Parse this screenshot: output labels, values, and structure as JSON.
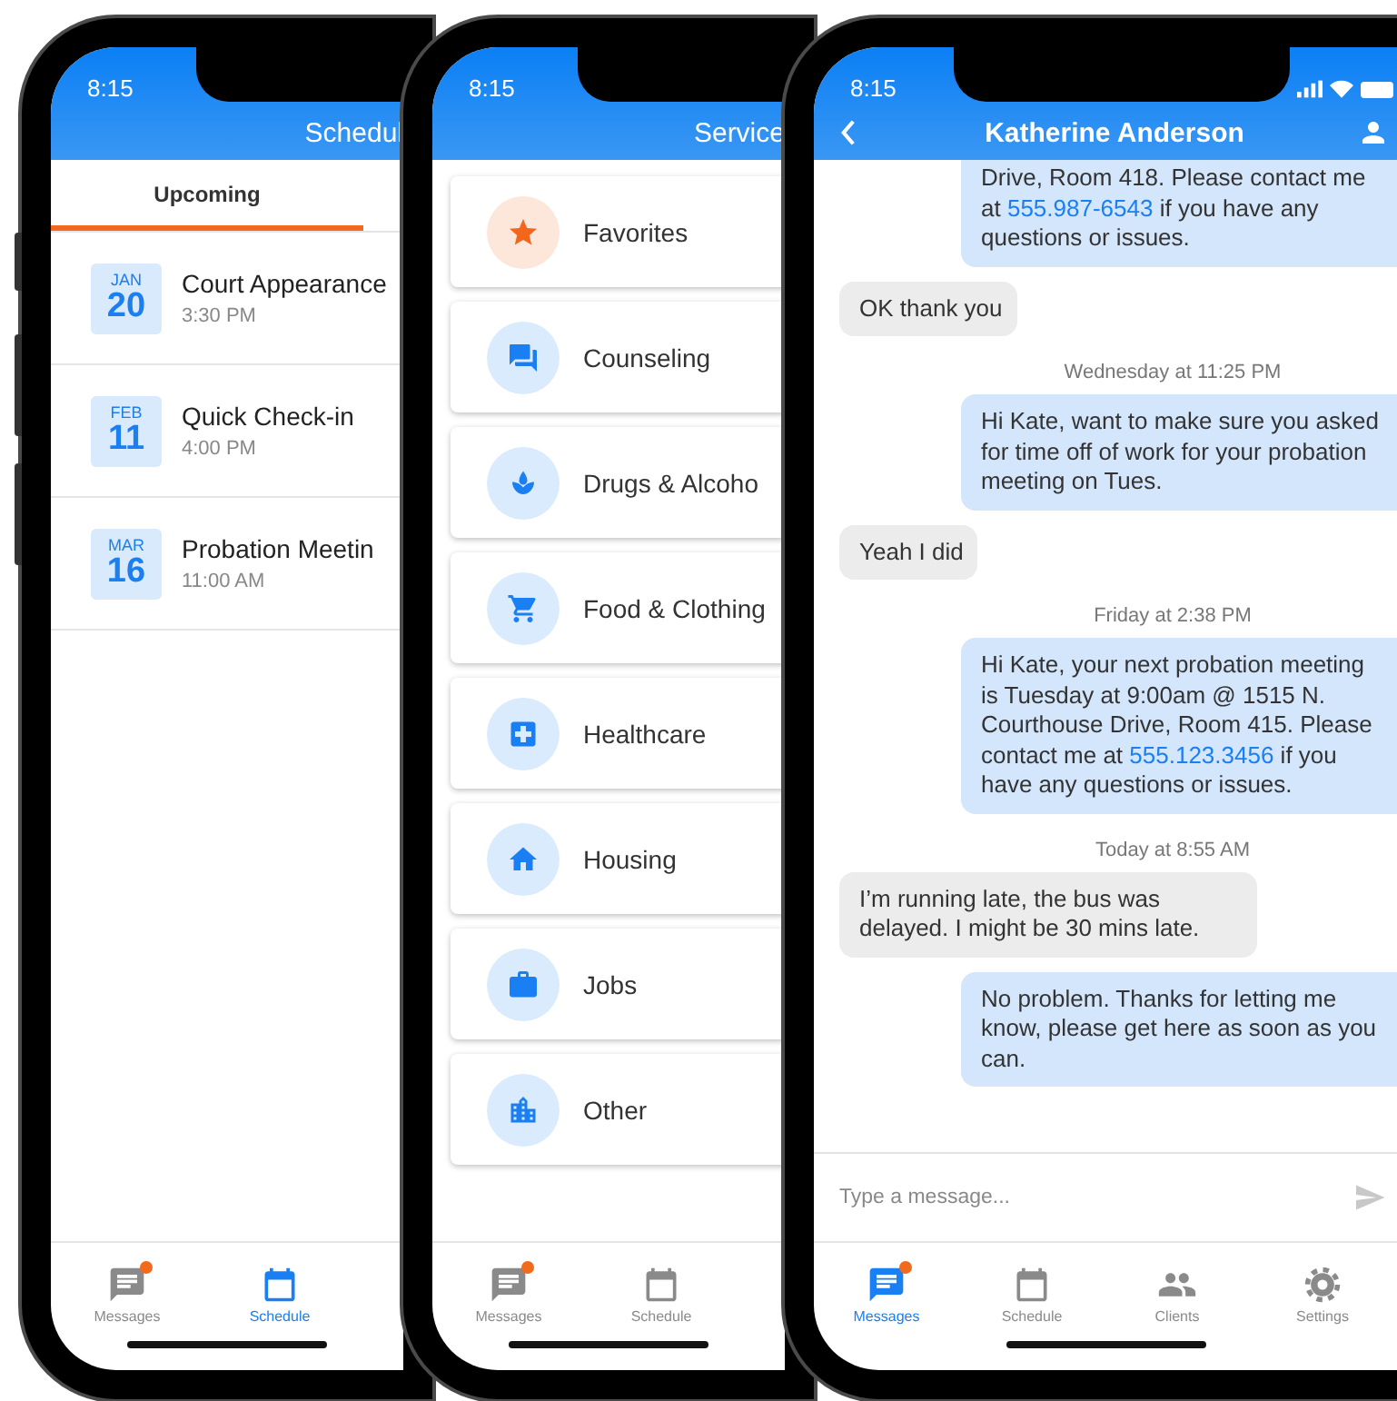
{
  "phones": [
    {
      "kind": "schedule",
      "status_time": "8:15",
      "header": {
        "title": "Schedul"
      },
      "tabs": [
        {
          "label": "Upcoming",
          "selected": true
        }
      ],
      "events": [
        {
          "month": "JAN",
          "day": "20",
          "title": "Court Appearance",
          "time": "3:30 PM"
        },
        {
          "month": "FEB",
          "day": "11",
          "title": "Quick Check-in",
          "time": "4:00 PM"
        },
        {
          "month": "MAR",
          "day": "16",
          "title": "Probation Meetin",
          "time": "11:00 AM"
        }
      ],
      "nav": [
        {
          "label": "Messages",
          "kind": "messages",
          "selected": false,
          "badge": true
        },
        {
          "label": "Schedule",
          "kind": "calendar",
          "selected": true,
          "badge": false
        }
      ]
    },
    {
      "kind": "services",
      "status_time": "8:15",
      "header": {
        "title": "Service"
      },
      "services": [
        {
          "label": "Favorites",
          "kind": "star",
          "color": "#f4661b"
        },
        {
          "label": "Counseling",
          "kind": "forum",
          "color": "#1a7ff2"
        },
        {
          "label": "Drugs & Alcoho",
          "kind": "lotus",
          "color": "#1a7ff2"
        },
        {
          "label": "Food & Clothing",
          "kind": "cart",
          "color": "#1a7ff2"
        },
        {
          "label": "Healthcare",
          "kind": "medical",
          "color": "#1a7ff2"
        },
        {
          "label": "Housing",
          "kind": "house",
          "color": "#1a7ff2"
        },
        {
          "label": "Jobs",
          "kind": "briefcase",
          "color": "#1a7ff2"
        },
        {
          "label": "Other",
          "kind": "buildings",
          "color": "#1a7ff2"
        }
      ],
      "nav": [
        {
          "label": "Messages",
          "kind": "messages",
          "selected": false,
          "badge": true
        },
        {
          "label": "Schedule",
          "kind": "calendar",
          "selected": false,
          "badge": false
        }
      ]
    },
    {
      "kind": "chat",
      "status_time": "8:15",
      "header": {
        "title": "Katherine Anderson"
      },
      "messages": [
        {
          "kind": "outgoing",
          "parts": [
            {
              "text": "Drive, Room 418. Please contact me at "
            },
            {
              "text": "555.987-6543",
              "kind": "link"
            },
            {
              "text": " if you have any questions or issues."
            }
          ]
        },
        {
          "kind": "incoming",
          "parts": [
            {
              "text": "OK thank you"
            }
          ]
        },
        {
          "kind": "timestamp",
          "text": "Wednesday at 11:25 PM"
        },
        {
          "kind": "outgoing",
          "parts": [
            {
              "text": "Hi Kate, want to make sure you asked for time off of work for your probation meeting on Tues."
            }
          ]
        },
        {
          "kind": "incoming",
          "parts": [
            {
              "text": "Yeah I did"
            }
          ]
        },
        {
          "kind": "timestamp",
          "text": "Friday at 2:38 PM"
        },
        {
          "kind": "outgoing",
          "parts": [
            {
              "text": "Hi Kate, your next probation meeting is Tuesday at 9:00am @ 1515 N. Courthouse Drive, Room 415. Please contact me at "
            },
            {
              "text": "555.123.3456",
              "kind": "link"
            },
            {
              "text": " if you have any questions or issues."
            }
          ]
        },
        {
          "kind": "timestamp",
          "text": "Today at 8:55 AM"
        },
        {
          "kind": "incoming",
          "parts": [
            {
              "text": "I’m running late, the bus was delayed. I might be 30 mins late."
            }
          ]
        },
        {
          "kind": "outgoing",
          "parts": [
            {
              "text": "No problem. Thanks for letting me know, please get here as soon as you can."
            }
          ]
        }
      ],
      "composer": {
        "placeholder": "Type a message..."
      },
      "nav": [
        {
          "label": "Messages",
          "kind": "messages",
          "selected": true,
          "badge": true
        },
        {
          "label": "Schedule",
          "kind": "calendar",
          "selected": false,
          "badge": false
        },
        {
          "label": "Clients",
          "kind": "people",
          "selected": false,
          "badge": false
        },
        {
          "label": "Settings",
          "kind": "gear",
          "selected": false,
          "badge": false
        }
      ]
    }
  ]
}
